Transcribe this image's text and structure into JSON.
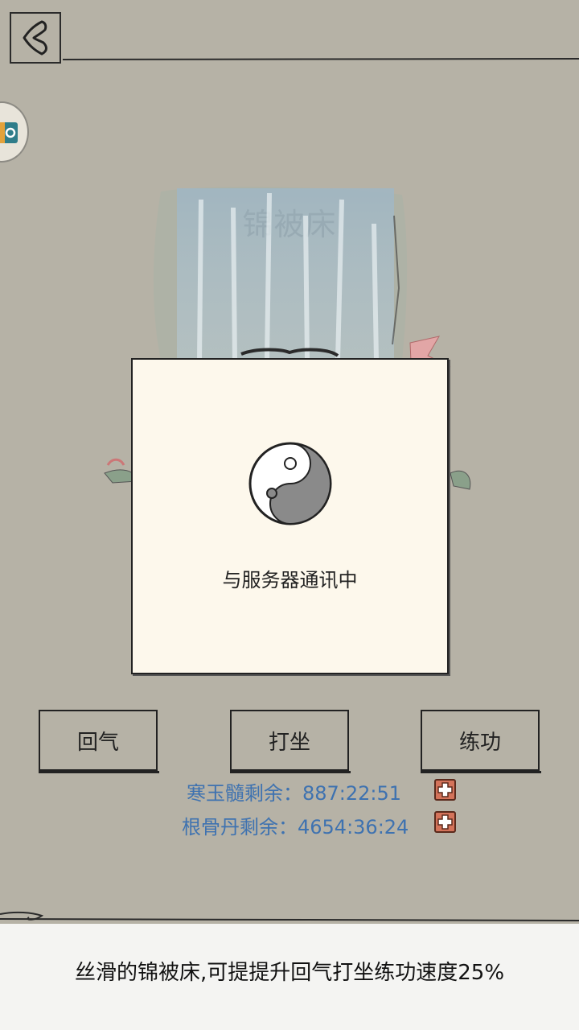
{
  "title": "锦被床",
  "dialog": {
    "message": "与服务器通讯中"
  },
  "buttons": {
    "huiqi": "回气",
    "dazuo": "打坐",
    "liangong": "练功"
  },
  "remaining": {
    "hanyusui": "寒玉髓剩余：887:22:51",
    "gengudan": "根骨丹剩余：4654:36:24"
  },
  "description": "丝滑的锦被床,可提提升回气打坐练功速度25%",
  "colors": {
    "background": "#b6b2a6",
    "dialog": "#fdf8ec",
    "timer_text": "#3e72b0",
    "plus_button": "#d4735a"
  },
  "icons": {
    "back": "back-arrow-icon",
    "loading": "taiji-icon",
    "plus": "plus-icon"
  }
}
